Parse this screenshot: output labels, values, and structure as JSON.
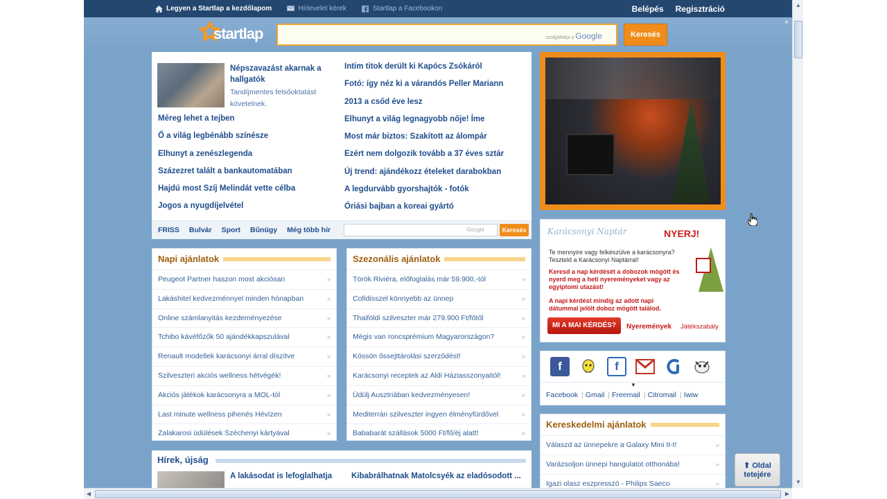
{
  "topbar": {
    "homepage": "Legyen a Startlap a kezdőlapom",
    "newsletter": "Hírlevelet kérek",
    "facebook": "Startlap a Facebookon",
    "login": "Belépés",
    "register": "Regisztráció"
  },
  "header": {
    "logo": "startlap",
    "search_powered": "szolgáltatja a",
    "search_google": "Google",
    "search_button": "Keresés",
    "close": "×"
  },
  "news": {
    "feature": {
      "title": "Népszavazást akarnak a hallgatók",
      "desc": "Tandíjmentes felsőoktatást követelnek."
    },
    "left": [
      "Méreg lehet a tejben",
      "Ő a világ legbénább színésze",
      "Elhunyt a zenészlegenda",
      "Százezret talált a bankautomatában",
      "Hajdú most Szíj Melindát vette célba",
      "Jogos a nyugdíjelvétel"
    ],
    "right": [
      "Intim titok derült ki Kapócs Zsókáról",
      "Fotó: így néz ki a várandós Peller Mariann",
      "2013 a csőd éve lesz",
      "Elhunyt a világ legnagyobb nője! Íme",
      "Most már biztos: Szakított az álompár",
      "Ezért nem dolgozik tovább a 37 éves sztár",
      "Új trend: ajándékozz ételeket darabokban",
      "A legdurvább gyorshajtók - fotók",
      "Óriási bajban a koreai gyártó"
    ],
    "tabs": [
      "FRISS",
      "Bulvár",
      "Sport",
      "Bűnügy",
      "Még több hír"
    ],
    "mini_google": "Google",
    "mini_button": "Keresés"
  },
  "napi": {
    "title": "Napi ajánlatok",
    "items": [
      "Peugeot Partner haszon most akciósan",
      "Lakáshitel kedvezménnyel minden hónapban",
      "Online számlanyitás kezdeményezése",
      "Tchibo kávéfőzők 50 ajándékkapszulával",
      "Renault modellek karácsonyi árral díszítve",
      "Szilveszteri akciós wellness hétvégék!",
      "Akciós játékok karácsonyra a MOL-tól",
      "Last minute wellness pihenés Hévízen",
      "Zalakarosi üdülések Széchenyi kártyával"
    ]
  },
  "szezonalis": {
    "title": "Szezonális ajánlatok",
    "items": [
      "Török Riviéra, előfoglalás már 59.900,-tól",
      "Cofidisszel könnyebb az ünnep",
      "Thaiföldi szilveszter már 279.900 Ft/főtől",
      "Mégis van roncsprémium Magyarországon?",
      "Kössön őssejttárolási szerződést!",
      "Karácsonyi receptek az Aldi Háziasszonyaitól!",
      "Üdülj Ausztriában kedvezményesen!",
      "Mediterrán szilveszter ingyen élményfürdővel",
      "Bababarát szállások 5000 Ft/fő/éj alatt!"
    ]
  },
  "hirek": {
    "title": "Hírek, újság",
    "item1": "A lakásodat is lefoglalhatja",
    "item2": "Kibabrálhatnak Matolcsyék az eladósodott ..."
  },
  "advent": {
    "title": "Karácsonyi Naptár",
    "nyerj": "NYERJ!",
    "p1": "Te mennyire vagy felkészülve a karácsonyra? Teszteld a Karácsonyi Naptárral!",
    "p2": "Keresd a nap kérdését a dobozok mögött és nyerd meg a heti nyereményeket vagy az egyiptomi utazást!",
    "p3": "A napi kérdést mindig az adott napi dátummal jelölt doboz mögött találod.",
    "button": "MI A MAI KÉRDÉS?",
    "link1": "Nyeremények",
    "link2": "Játékszabály"
  },
  "social": {
    "links": [
      "Facebook",
      "Gmail",
      "Freemail",
      "Citromail",
      "Iwiw"
    ]
  },
  "kereskedelmi": {
    "title": "Kereskedelmi ajánlatok",
    "items": [
      "Válaszd az ünnepekre a Galaxy Mini II-t!",
      "Varázsoljon ünnepi hangulatot otthonába!",
      "Igazi olasz eszpresszó - Philips Saeco"
    ]
  },
  "oldal": {
    "line1": "Oldal",
    "line2": "tetejére"
  },
  "colors": {
    "page_bg": "#7aa3c9",
    "topbar": "#23476f",
    "accent_orange": "#f08d1a",
    "link_blue": "#1e4c8c"
  }
}
